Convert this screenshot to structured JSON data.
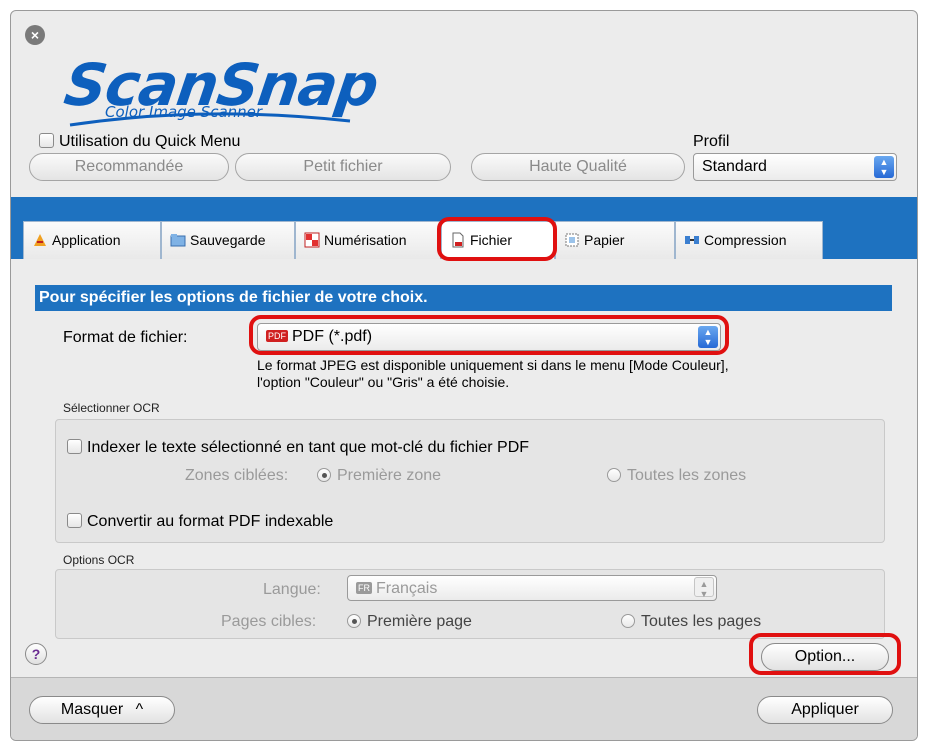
{
  "window": {
    "close_icon": "close-icon",
    "logo": {
      "main": "ScanSnap",
      "sub": "Color Image Scanner"
    }
  },
  "header": {
    "quick_menu_label": "Utilisation du Quick Menu",
    "profil_label": "Profil",
    "presets": [
      "Recommandée",
      "Petit fichier",
      "Haute Qualité"
    ],
    "profil_value": "Standard"
  },
  "tabs": [
    {
      "label": "Application",
      "icon": "application-icon"
    },
    {
      "label": "Sauvegarde",
      "icon": "folder-icon"
    },
    {
      "label": "Numérisation",
      "icon": "scan-icon"
    },
    {
      "label": "Fichier",
      "icon": "file-icon",
      "active": true
    },
    {
      "label": "Papier",
      "icon": "paper-icon"
    },
    {
      "label": "Compression",
      "icon": "compression-icon"
    }
  ],
  "main": {
    "section_title": "Pour spécifier les options de fichier de votre choix.",
    "format_label": "Format de fichier:",
    "format_value": "PDF (*.pdf)",
    "format_badge": "PDF",
    "hint_line1": "Le format JPEG est disponible uniquement si dans le menu [Mode Couleur],",
    "hint_line2": "l'option \"Couleur\" ou \"Gris\" a été choisie.",
    "ocr_select_title": "Sélectionner OCR",
    "index_text_label": "Indexer le texte sélectionné en tant que mot-clé du fichier PDF",
    "zones_label": "Zones ciblées:",
    "zone_first": "Première zone",
    "zone_all": "Toutes les zones",
    "convert_label": "Convertir au format PDF indexable",
    "ocr_options_title": "Options OCR",
    "langue_label": "Langue:",
    "langue_badge": "FR",
    "langue_value": "Français",
    "pages_label": "Pages cibles:",
    "page_first": "Première page",
    "page_all": "Toutes les pages",
    "help_label": "?",
    "option_button": "Option..."
  },
  "footer": {
    "hide_button": "Masquer",
    "hide_chevron": "^",
    "apply_button": "Appliquer"
  },
  "colors": {
    "accent_blue": "#1e72c0",
    "highlight_red": "#e01010",
    "logo_blue": "#0d5fbd"
  }
}
